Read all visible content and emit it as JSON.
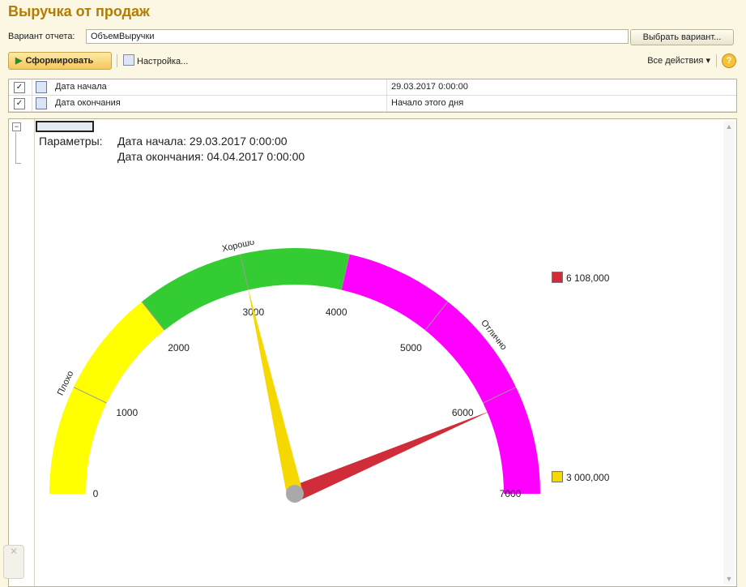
{
  "window": {
    "title": "Выручка от продаж"
  },
  "variant": {
    "label": "Вариант отчета:",
    "value": "ОбъемВыручки",
    "choose_button": "Выбрать вариант..."
  },
  "toolbar": {
    "form_button": "Сформировать",
    "settings_button": "Настройка...",
    "all_actions": "Все действия",
    "help": "?"
  },
  "params": [
    {
      "checked": true,
      "name": "Дата начала",
      "value": "29.03.2017 0:00:00"
    },
    {
      "checked": true,
      "name": "Дата окончания",
      "value": "Начало этого дня"
    }
  ],
  "report": {
    "params_label": "Параметры:",
    "param_lines": [
      "Дата начала: 29.03.2017 0:00:00",
      "Дата окончания: 04.04.2017 0:00:00"
    ]
  },
  "chart_data": {
    "type": "gauge",
    "min": 0,
    "max": 7000,
    "ticks": [
      0,
      1000,
      2000,
      3000,
      4000,
      5000,
      6000,
      7000
    ],
    "bands": [
      {
        "from": 0,
        "to": 2000,
        "label": "Плохо",
        "color": "#ffff00"
      },
      {
        "from": 2000,
        "to": 4000,
        "label": "Хорошо",
        "color": "#33cc33"
      },
      {
        "from": 4000,
        "to": 7000,
        "label": "Отлично",
        "color": "#ff00ff"
      }
    ],
    "pointers": [
      {
        "value": 6108,
        "label": "6 108,000",
        "color": "#d12c3a"
      },
      {
        "value": 3000,
        "label": "3 000,000",
        "color": "#f5d800"
      }
    ]
  }
}
